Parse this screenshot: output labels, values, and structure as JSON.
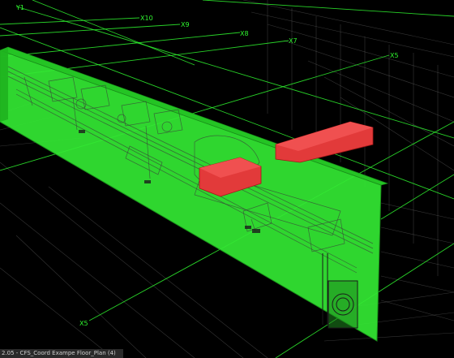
{
  "colors": {
    "background": "#000000",
    "grid_line": "#2ff52f",
    "wall_fill": "#33e833",
    "clash_box": "#e23a3a",
    "wireframe": "#cfcfcf"
  },
  "grid_labels": {
    "y1": "Y1",
    "x10": "X10",
    "x9": "X9",
    "x8": "X8",
    "x7": "X7",
    "x5_top": "X5",
    "x5_bottom": "X5"
  },
  "status": {
    "text": "2.05 - CFS_Coord Exampe Floor_Plan (4)"
  },
  "icons": {
    "duct_fitting": "duct-elbow-icon"
  }
}
